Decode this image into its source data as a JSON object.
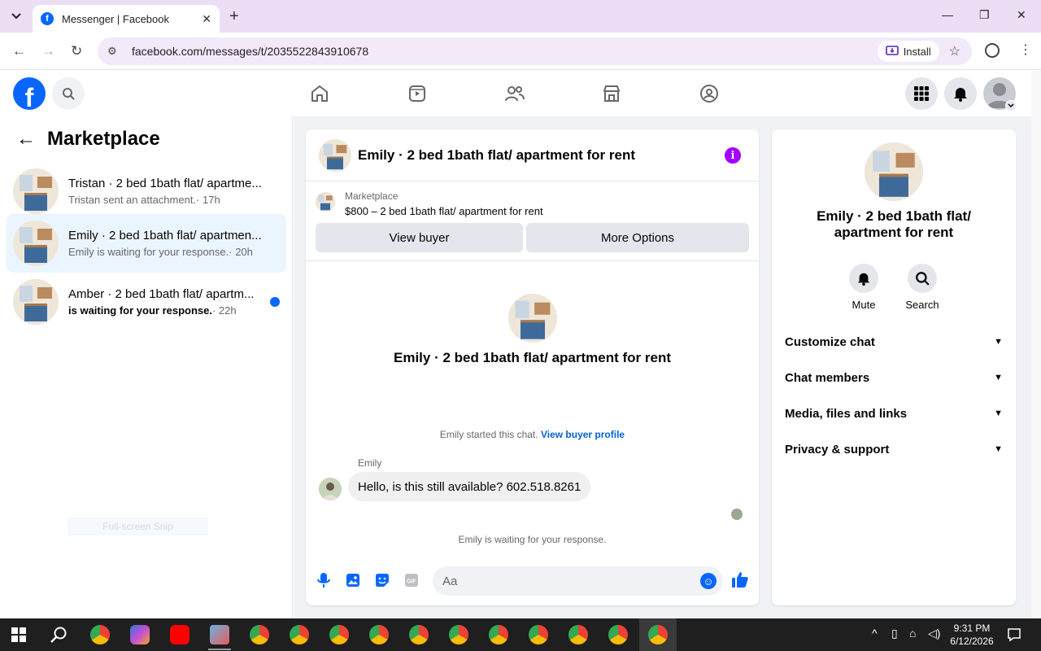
{
  "browser": {
    "tab_title": "Messenger | Facebook",
    "url": "facebook.com/messages/t/2035522843910678",
    "install_label": "Install"
  },
  "left_panel": {
    "title": "Marketplace",
    "conversations": [
      {
        "name": "Tristan · 2 bed 1bath flat/ apartme...",
        "preview": "Tristan sent an attachment.",
        "time": "· 17h",
        "unread": false
      },
      {
        "name": "Emily · 2 bed 1bath flat/ apartmen...",
        "preview": "Emily is waiting for your response.",
        "time": "· 20h",
        "unread": false
      },
      {
        "name": "Amber · 2 bed 1bath flat/ apartm...",
        "preview": "is waiting for your response.",
        "time": "· 22h",
        "unread": true
      }
    ],
    "snip_ghost": "Full-screen Snip"
  },
  "chat": {
    "header_name": "Emily · 2 bed 1bath flat/ apartment for rent",
    "marketplace_label": "Marketplace",
    "listing": "$800 – 2 bed 1bath flat/ apartment for rent",
    "view_buyer_label": "View buyer",
    "more_options_label": "More Options",
    "intro_name": "Emily · 2 bed 1bath flat/ apartment for rent",
    "started_text": "Emily started this chat.",
    "buyer_profile_link": "View buyer profile",
    "sender": "Emily",
    "message": "Hello, is this still available? 602.518.8261",
    "waiting_text": "Emily is waiting for your response.",
    "input_placeholder": "Aa"
  },
  "right_panel": {
    "name": "Emily · 2 bed 1bath flat/ apartment for rent",
    "mute_label": "Mute",
    "search_label": "Search",
    "sections": [
      "Customize chat",
      "Chat members",
      "Media, files and links",
      "Privacy & support"
    ]
  },
  "taskbar": {
    "time": "9:31 PM",
    "date": "6/12/2026"
  },
  "colors": {
    "brand": "#0866ff",
    "info_purple": "#a200ff",
    "active_row": "#ebf5ff"
  }
}
